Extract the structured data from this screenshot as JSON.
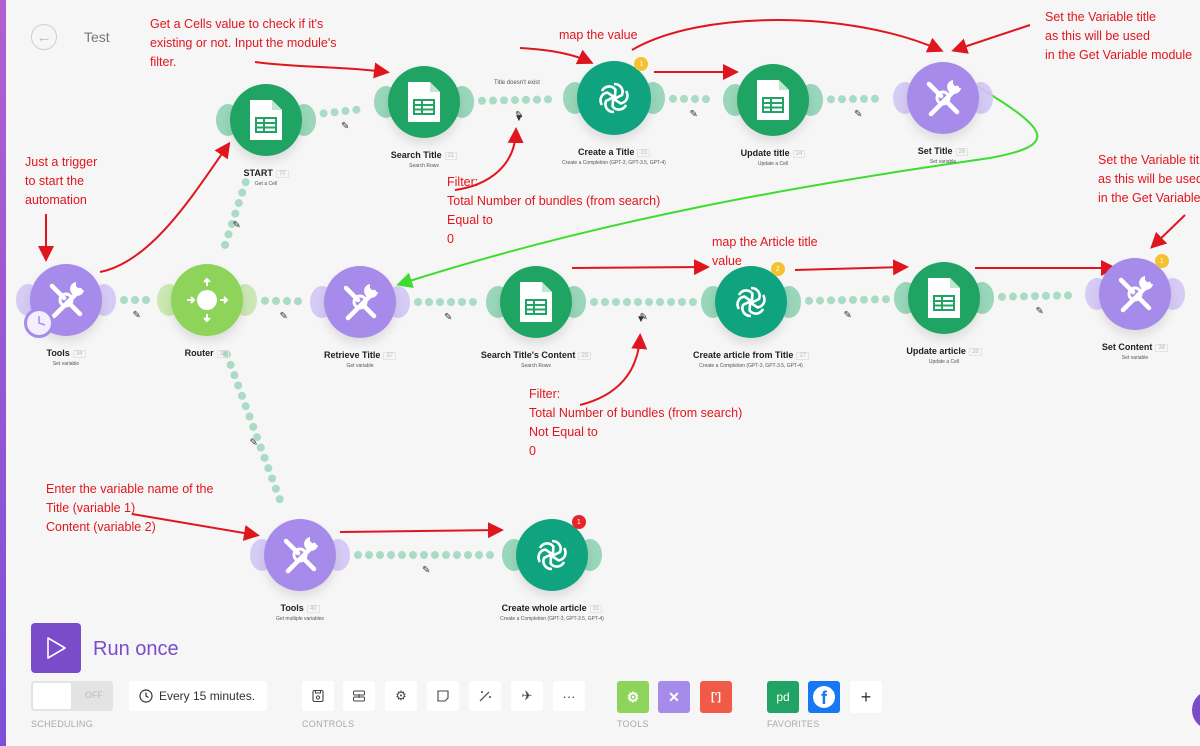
{
  "header": {
    "title": "Test",
    "back_icon": "arrow-left-icon"
  },
  "colors": {
    "sheets": "#1fa463",
    "openai": "#10a37f",
    "tools": "#a78bea",
    "router": "#8ed35a",
    "annotation": "#e0161e",
    "green_arrow": "#3ddc2f",
    "accent": "#7a4cc9"
  },
  "modules": [
    {
      "id": "start",
      "name": "START",
      "number": "70",
      "subtitle": "Get a Cell",
      "app": "google-sheets"
    },
    {
      "id": "search-title",
      "name": "Search Title",
      "number": "21",
      "subtitle": "Search Rows",
      "app": "google-sheets"
    },
    {
      "id": "create-title",
      "name": "Create a Title",
      "number": "23",
      "subtitle": "Create a Completion (GPT-3, GPT-3.5, GPT-4)",
      "app": "openai",
      "badge": "1"
    },
    {
      "id": "update-title",
      "name": "Update title",
      "number": "24",
      "subtitle": "Update a Cell",
      "app": "google-sheets"
    },
    {
      "id": "set-title",
      "name": "Set Title",
      "number": "26",
      "subtitle": "Set variable",
      "app": "tools"
    },
    {
      "id": "tools-trigger",
      "name": "Tools",
      "number": "34",
      "subtitle": "Set variable",
      "app": "tools"
    },
    {
      "id": "router",
      "name": "Router",
      "number": "35",
      "subtitle": "",
      "app": "router"
    },
    {
      "id": "retrieve-title",
      "name": "Retrieve Title",
      "number": "37",
      "subtitle": "Get variable",
      "app": "tools"
    },
    {
      "id": "search-content",
      "name": "Search Title's Content",
      "number": "25",
      "subtitle": "Search Rows",
      "app": "google-sheets"
    },
    {
      "id": "create-article",
      "name": "Create article from Title",
      "number": "27",
      "subtitle": "Create a Completion (GPT-3, GPT-3.5, GPT-4)",
      "app": "openai",
      "badge": "2"
    },
    {
      "id": "update-article",
      "name": "Update article",
      "number": "28",
      "subtitle": "Update a Cell",
      "app": "google-sheets"
    },
    {
      "id": "set-content",
      "name": "Set Content",
      "number": "38",
      "subtitle": "Set variable",
      "app": "tools",
      "badge": "1"
    },
    {
      "id": "tools-get",
      "name": "Tools",
      "number": "40",
      "subtitle": "Get multiple variables",
      "app": "tools"
    },
    {
      "id": "create-whole",
      "name": "Create whole article",
      "number": "31",
      "subtitle": "Create a Completion (GPT-3, GPT-3.5, GPT-4)",
      "app": "openai",
      "badge": "1",
      "badge_color": "#e8232a"
    }
  ],
  "filters": {
    "title_check": "Title doesn't exist"
  },
  "annotations": {
    "get_cells": "Get a Cells value to check if it's\nexisting or not. Input the module's\nfilter.",
    "map_value": "map the value",
    "set_var_title": "Set the Variable title\nas this will be used\nin the Get Variable module",
    "trigger": "Just a trigger\nto start the\nautomation",
    "filter_equal": "Filter:\nTotal Number of bundles (from search)\nEqual to\n0",
    "map_article": "map the Article title\nvalue",
    "set_var_content": "Set the Variable title\nas this will be used\nin the Get Variable module",
    "filter_not_equal": "Filter:\nTotal Number of bundles (from search)\nNot Equal to\n0",
    "enter_var": "Enter the variable name of the\nTitle (variable 1)\nContent (variable 2)"
  },
  "toolbar": {
    "run_once": "Run once",
    "toggle": "OFF",
    "schedule": "Every 15 minutes.",
    "scheduling_label": "SCHEDULING",
    "controls_label": "CONTROLS",
    "tools_label": "TOOLS",
    "favorites_label": "FAVORITES",
    "controls": [
      "save-icon",
      "auto-align-icon",
      "settings-icon",
      "notes-icon",
      "magic-wand-icon",
      "airplane-icon",
      "more-icon"
    ],
    "tools": [
      "flow-control-icon",
      "tools-icon",
      "json-icon"
    ],
    "favorites": [
      "pipedrive-icon",
      "facebook-icon",
      "add-icon"
    ],
    "more_glyph": "···",
    "json_glyph": "[']",
    "pd_glyph": "pd",
    "fb_glyph": "f",
    "plus_glyph": "+"
  }
}
